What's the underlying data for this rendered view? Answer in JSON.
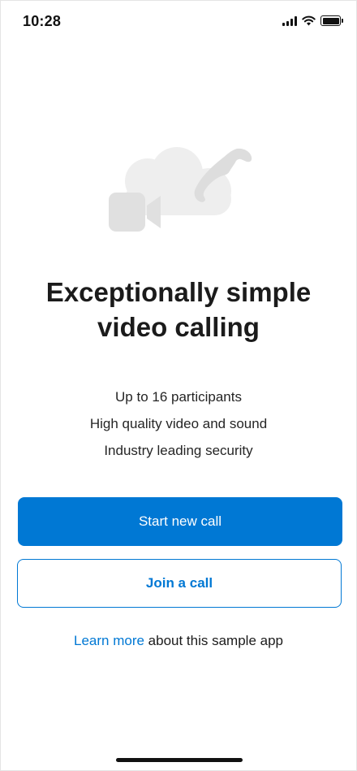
{
  "status_bar": {
    "time": "10:28"
  },
  "hero": {
    "icons": [
      "cloud-icon",
      "video-camera-icon",
      "phone-icon"
    ]
  },
  "headline": {
    "line1": "Exceptionally simple",
    "line2": "video calling"
  },
  "features": [
    "Up to 16 participants",
    "High quality video and sound",
    "Industry leading security"
  ],
  "actions": {
    "start_label": "Start new call",
    "join_label": "Join a call"
  },
  "footer": {
    "link_text": "Learn more",
    "suffix": " about this sample app"
  },
  "colors": {
    "accent": "#0078d4",
    "illustration": "#e8e8e8"
  }
}
